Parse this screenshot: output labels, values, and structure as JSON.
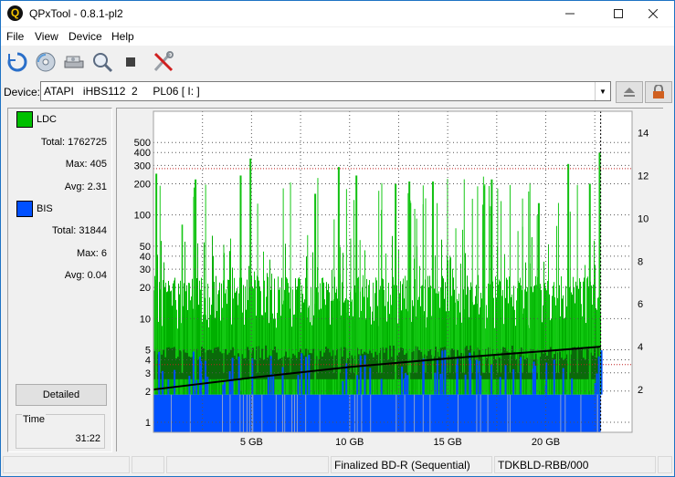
{
  "window": {
    "title": "QPxTool - 0.8.1-pl2",
    "app_icon": "Q"
  },
  "menu": [
    "File",
    "View",
    "Device",
    "Help"
  ],
  "device": {
    "label": "Device:",
    "value": "ATAPI   iHBS112  2     PL06 [ I: ]"
  },
  "legend": {
    "ldc": {
      "name": "LDC",
      "color": "#00c000",
      "total_label": "Total:",
      "total": "1762725",
      "max_label": "Max:",
      "max": "405",
      "avg_label": "Avg:",
      "avg": "2.31"
    },
    "bis": {
      "name": "BIS",
      "color": "#0050ff",
      "total_label": "Total:",
      "total": "31844",
      "max_label": "Max:",
      "max": "6",
      "avg_label": "Avg:",
      "avg": "0.04"
    }
  },
  "detailed_button": "Detailed",
  "time": {
    "label": "Time",
    "value": "31:22"
  },
  "status": [
    "",
    "",
    "",
    "Finalized BD-R (Sequential)",
    "TDKBLD-RBB/000",
    ""
  ],
  "colors": {
    "ldc": "#00c000",
    "bis": "#0050ff",
    "speed": "#000000"
  },
  "chart_data": {
    "type": "bar",
    "y_left_scale": "log",
    "y_left_ticks": [
      "1",
      "2",
      "3",
      "4",
      "5",
      "10",
      "20",
      "30",
      "40",
      "50",
      "100",
      "200",
      "300",
      "400",
      "500"
    ],
    "y_left_range": [
      0.8,
      1000
    ],
    "y_right_ticks": [
      "2",
      "4",
      "6",
      "8",
      "10",
      "12",
      "14"
    ],
    "y_right_range": [
      0,
      15
    ],
    "x_ticks": [
      "5 GB",
      "10 GB",
      "15 GB",
      "20 GB"
    ],
    "x_range_gb": [
      0,
      24.4
    ],
    "disc_end_gb": 22.8,
    "series": [
      {
        "name": "LDC",
        "color": "#00c000"
      },
      {
        "name": "BIS",
        "color": "#0050ff"
      }
    ],
    "ldc_peaks": [
      {
        "x": 0.1,
        "y": 250
      },
      {
        "x": 2.1,
        "y": 220
      },
      {
        "x": 4.4,
        "y": 240
      },
      {
        "x": 4.9,
        "y": 350
      },
      {
        "x": 8.2,
        "y": 160
      },
      {
        "x": 9.4,
        "y": 290
      },
      {
        "x": 10.3,
        "y": 240
      },
      {
        "x": 12.3,
        "y": 200
      },
      {
        "x": 13.0,
        "y": 210
      },
      {
        "x": 14.2,
        "y": 210
      },
      {
        "x": 17.2,
        "y": 220
      },
      {
        "x": 19.6,
        "y": 130
      },
      {
        "x": 21.1,
        "y": 310
      },
      {
        "x": 22.2,
        "y": 200
      },
      {
        "x": 22.7,
        "y": 400
      }
    ],
    "speed_curve": [
      {
        "x": 0,
        "y": 2.0
      },
      {
        "x": 5,
        "y": 2.55
      },
      {
        "x": 10,
        "y": 3.05
      },
      {
        "x": 15,
        "y": 3.45
      },
      {
        "x": 20,
        "y": 3.8
      },
      {
        "x": 22.8,
        "y": 4.0
      }
    ]
  }
}
